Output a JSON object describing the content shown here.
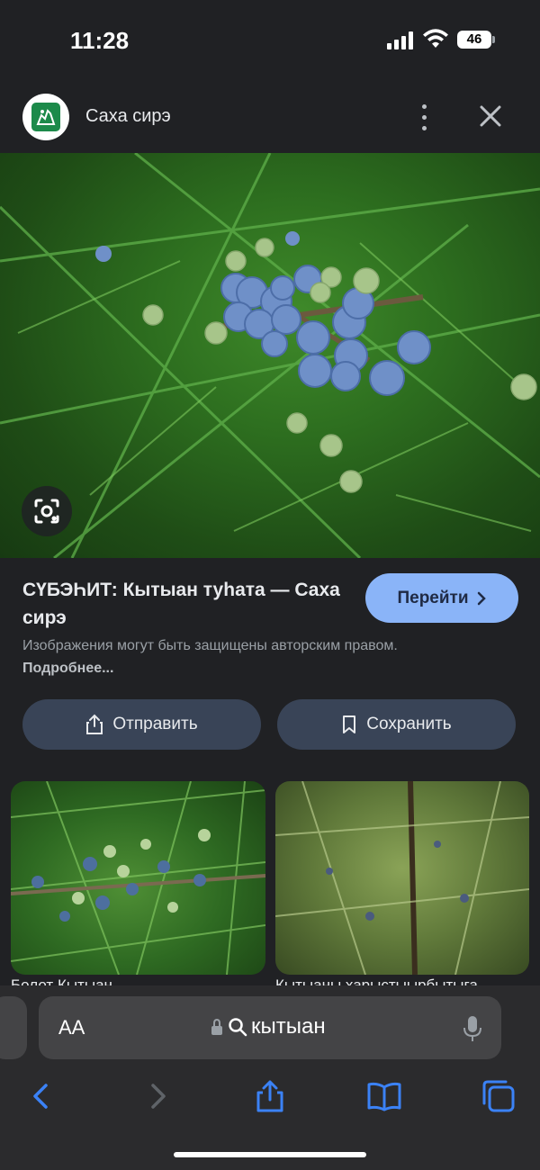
{
  "status": {
    "time": "11:28",
    "battery": "46",
    "icons": [
      "signal-icon",
      "wifi-icon",
      "battery-icon"
    ]
  },
  "header": {
    "site_name": "Саха сирэ",
    "icons": [
      "site-logo",
      "more-vert-icon",
      "close-icon"
    ]
  },
  "result": {
    "title": "СҮБЭҺИТ: Кытыан туһата — Саха сирэ",
    "goto_label": "Перейти",
    "copyright_text": "Изображения могут быть защищены авторским правом.",
    "more_link": "Подробнее..."
  },
  "actions": {
    "send_label": "Отправить",
    "save_label": "Сохранить"
  },
  "related": [
    {
      "caption": "Болот Кытыан..."
    },
    {
      "caption": "Кытыаны харыстыырбытыга"
    }
  ],
  "safari": {
    "aa_label": "AA",
    "url_text": "кытыан",
    "icons": [
      "lock-icon",
      "search-icon",
      "mic-icon",
      "back-icon",
      "forward-icon",
      "share-icon",
      "bookmarks-icon",
      "tabs-icon"
    ]
  },
  "colors": {
    "background": "#202124",
    "accent_button": "#8ab4f8",
    "secondary_button": "#394457",
    "safari_link": "#3b82f6"
  }
}
